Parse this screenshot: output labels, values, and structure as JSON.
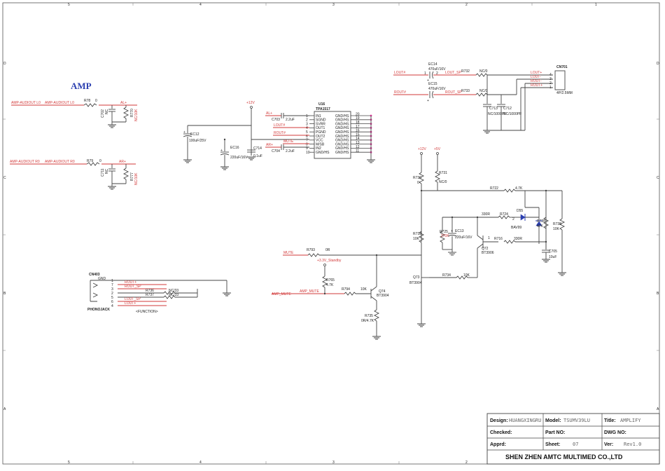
{
  "sheet_title": "AMP",
  "border": {
    "top_cols": [
      "5",
      "4",
      "3",
      "2",
      "1"
    ],
    "side_rows": [
      "D",
      "C",
      "B",
      "A"
    ]
  },
  "nets": {
    "amp_audiout_l": "AMP-AUDIOUT L0",
    "amp_audiout_r": "AMP-AUDIOUT R0",
    "al_plus": "AL+",
    "ar_plus": "AR+",
    "lout_hash": "LOUT#",
    "rout_hash": "ROUT#",
    "lout_sp": "LOUT_SP",
    "rout_sp": "ROUT_SP",
    "mute": "MUTE",
    "amp_mute": "AMP_MUTE",
    "v12": "+12V",
    "v5": "+5V",
    "standby": "+3.3V_Standby",
    "lout_plus": "LOUT+",
    "lout_minus": "LOUT-",
    "rout_minus": "ROUT-",
    "rout_plus": "ROUT+"
  },
  "components": {
    "r_in_l": {
      "ref": "R78",
      "val": "0"
    },
    "r_in_r": {
      "ref": "R79",
      "val": "0"
    },
    "c_in_l": {
      "ref": "C702",
      "val": "NC"
    },
    "c_in_r": {
      "ref": "C711",
      "val": "NC"
    },
    "r_nc_l": {
      "ref": "R770",
      "val": "NC/10K"
    },
    "r_nc_r": {
      "ref": "R777",
      "val": "NC/10K"
    },
    "ec12": {
      "ref": "EC12",
      "val": "100uF/25V"
    },
    "ec16": {
      "ref": "EC16",
      "val": "220uF/16V"
    },
    "c714": {
      "ref": "C714",
      "val": "0.1uF"
    },
    "c703": {
      "ref": "C703",
      "val": "2.2uF"
    },
    "c704": {
      "ref": "C704",
      "val": "2.2uF"
    },
    "ec14": {
      "ref": "EC14",
      "val": "470uF/16V"
    },
    "ec15": {
      "ref": "EC15",
      "val": "470uF/16V"
    },
    "r732": {
      "ref": "R732",
      "val": "NC/0"
    },
    "r733": {
      "ref": "R733",
      "val": "NC/0"
    },
    "c713": {
      "ref": "C713",
      "val": "NC/1000PF"
    },
    "c712": {
      "ref": "C712",
      "val": "NC/1000PF"
    },
    "cn701": {
      "ref": "CN701",
      "val": "4P/2.5MM"
    },
    "r730": {
      "ref": "R730",
      "val": "0"
    },
    "r731": {
      "ref": "R731",
      "val": "NC/0"
    },
    "r722": {
      "ref": "R722",
      "val": "4.7K"
    },
    "r724": {
      "ref": "R724",
      "val": "330R"
    },
    "d55": {
      "ref": "D55",
      "val": "BAV99"
    },
    "r728": {
      "ref": "R728",
      "val": "47K"
    },
    "r738": {
      "ref": "R738",
      "val": "10K"
    },
    "r718": {
      "ref": "R718",
      "val": "10K"
    },
    "r725": {
      "ref": "R725",
      "val": "270K"
    },
    "ec13": {
      "ref": "EC13",
      "val": "220uF/16V"
    },
    "r716": {
      "ref": "R716",
      "val": "330R"
    },
    "q72": {
      "ref": "Q72",
      "val": "BT3906"
    },
    "c705": {
      "ref": "C705",
      "val": "10uF"
    },
    "r793": {
      "ref": "R793",
      "val": "0R"
    },
    "r765": {
      "ref": "R765",
      "val": "4.7K"
    },
    "r794": {
      "ref": "R794",
      "val": "10K"
    },
    "q74": {
      "ref": "Q74",
      "val": "BT3904"
    },
    "r735": {
      "ref": "R735",
      "val": "0R/4.7K"
    },
    "q73": {
      "ref": "Q73",
      "val": "BT3904"
    },
    "r734": {
      "ref": "R734",
      "val": "10K"
    },
    "cn403": {
      "ref": "CN403",
      "val": "PHONOJACK"
    },
    "r736": {
      "ref": "R736",
      "val": "NC/33"
    },
    "r737": {
      "ref": "R737",
      "val": "NC/33"
    }
  },
  "ic": {
    "ref": "U16",
    "part": "TPA1517",
    "left_pins": [
      {
        "num": "1",
        "name": "IN1"
      },
      {
        "num": "2",
        "name": "SGND"
      },
      {
        "num": "3",
        "name": "SVRR"
      },
      {
        "num": "4",
        "name": "OUT1"
      },
      {
        "num": "5",
        "name": "PGND"
      },
      {
        "num": "6",
        "name": "OUT2"
      },
      {
        "num": "7",
        "name": "VCC"
      },
      {
        "num": "8",
        "name": "M/SB"
      },
      {
        "num": "9",
        "name": "IN2"
      },
      {
        "num": "10",
        "name": "GND/HS"
      }
    ],
    "right_pins": [
      {
        "num": "20",
        "name": "GND/HS"
      },
      {
        "num": "19",
        "name": "GND/HS"
      },
      {
        "num": "18",
        "name": "GND/HS"
      },
      {
        "num": "17",
        "name": "GND/HS"
      },
      {
        "num": "16",
        "name": "GND/HS"
      },
      {
        "num": "15",
        "name": "GND/HS"
      },
      {
        "num": "14",
        "name": "GND/HS"
      },
      {
        "num": "13",
        "name": "GND/HS"
      },
      {
        "num": "12",
        "name": "GND/HS"
      },
      {
        "num": "11",
        "name": "GND/HS"
      }
    ]
  },
  "jack": {
    "pins": [
      "1",
      "7",
      "3",
      "2",
      "5",
      "6",
      "4"
    ],
    "gnd": "GND",
    "function_label": "<FUNCTION>"
  },
  "title_block": {
    "design_label": "Design:",
    "design_value": "HUANGXINGRU",
    "model_label": "Model:",
    "model_value": "TSUMV39LU",
    "title_label": "Title:",
    "title_value": "AMPLIFY",
    "checked_label": "Checked:",
    "checked_value": "",
    "partno_label": "Part NO:",
    "partno_value": "",
    "dwgno_label": "DWG NO:",
    "dwgno_value": "",
    "apprd_label": "Apprd:",
    "apprd_value": "",
    "sheet_label": "Sheet:",
    "sheet_value": "07",
    "ver_label": "Ver:",
    "ver_value": "Rev1.0",
    "company": "SHEN ZHEN AMTC MULTIMED CO.,LTD"
  }
}
